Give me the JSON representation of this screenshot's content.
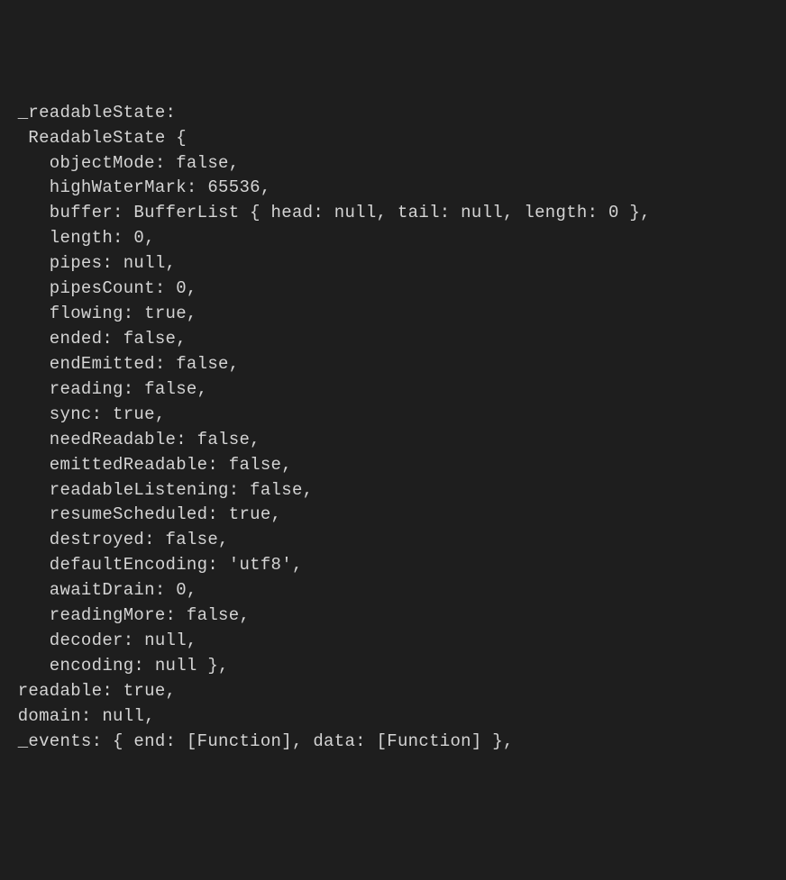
{
  "lines": [
    " _readableState:",
    "  ReadableState {",
    "    objectMode: false,",
    "    highWaterMark: 65536,",
    "    buffer: BufferList { head: null, tail: null, length: 0 },",
    "    length: 0,",
    "    pipes: null,",
    "    pipesCount: 0,",
    "    flowing: true,",
    "    ended: false,",
    "    endEmitted: false,",
    "    reading: false,",
    "    sync: true,",
    "    needReadable: false,",
    "    emittedReadable: false,",
    "    readableListening: false,",
    "    resumeScheduled: true,",
    "    destroyed: false,",
    "    defaultEncoding: 'utf8',",
    "    awaitDrain: 0,",
    "    readingMore: false,",
    "    decoder: null,",
    "    encoding: null },",
    " readable: true,",
    " domain: null,",
    " _events: { end: [Function], data: [Function] },"
  ],
  "readableState": {
    "objectMode": false,
    "highWaterMark": 65536,
    "buffer": {
      "type": "BufferList",
      "head": null,
      "tail": null,
      "length": 0
    },
    "length": 0,
    "pipes": null,
    "pipesCount": 0,
    "flowing": true,
    "ended": false,
    "endEmitted": false,
    "reading": false,
    "sync": true,
    "needReadable": false,
    "emittedReadable": false,
    "readableListening": false,
    "resumeScheduled": true,
    "destroyed": false,
    "defaultEncoding": "utf8",
    "awaitDrain": 0,
    "readingMore": false,
    "decoder": null,
    "encoding": null
  },
  "readable": true,
  "domain": null,
  "_events": {
    "end": "[Function]",
    "data": "[Function]"
  }
}
